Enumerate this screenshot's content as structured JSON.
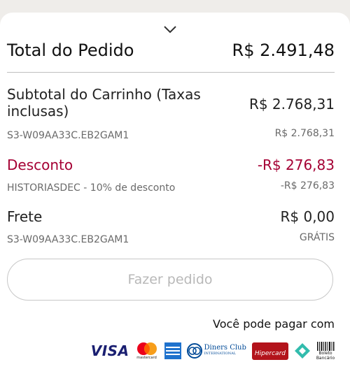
{
  "summary": {
    "total_label": "Total do Pedido",
    "total_value": "R$ 2.491,48"
  },
  "subtotal": {
    "label": "Subtotal do Carrinho (Taxas inclusas)",
    "value": "R$ 2.768,31",
    "sku": "S3-W09AA33C.EB2GAM1",
    "sku_value": "R$ 2.768,31"
  },
  "discount": {
    "label": "Desconto",
    "value": "-R$ 276,83",
    "code": "HISTORIASDEC - 10% de desconto",
    "code_value": "-R$ 276,83"
  },
  "shipping": {
    "label": "Frete",
    "value": "R$ 0,00",
    "sku": "S3-W09AA33C.EB2GAM1",
    "sku_value": "GRÁTIS"
  },
  "actions": {
    "place_order": "Fazer pedido"
  },
  "payment": {
    "text": "Você pode pagar com",
    "visa": "VISA",
    "mastercard": "mastercard",
    "diners_line1": "Diners Club",
    "diners_line2": "INTERNATIONAL",
    "hipercard": "Hipercard",
    "boleto_line1": "Boleto",
    "boleto_line2": "Bancário",
    "icons": [
      "visa-icon",
      "mastercard-icon",
      "amex-icon",
      "diners-icon",
      "hipercard-icon",
      "elo-icon",
      "boleto-icon"
    ]
  },
  "colors": {
    "discount_red": "#a50034",
    "disabled_text": "#b8b8b8"
  }
}
